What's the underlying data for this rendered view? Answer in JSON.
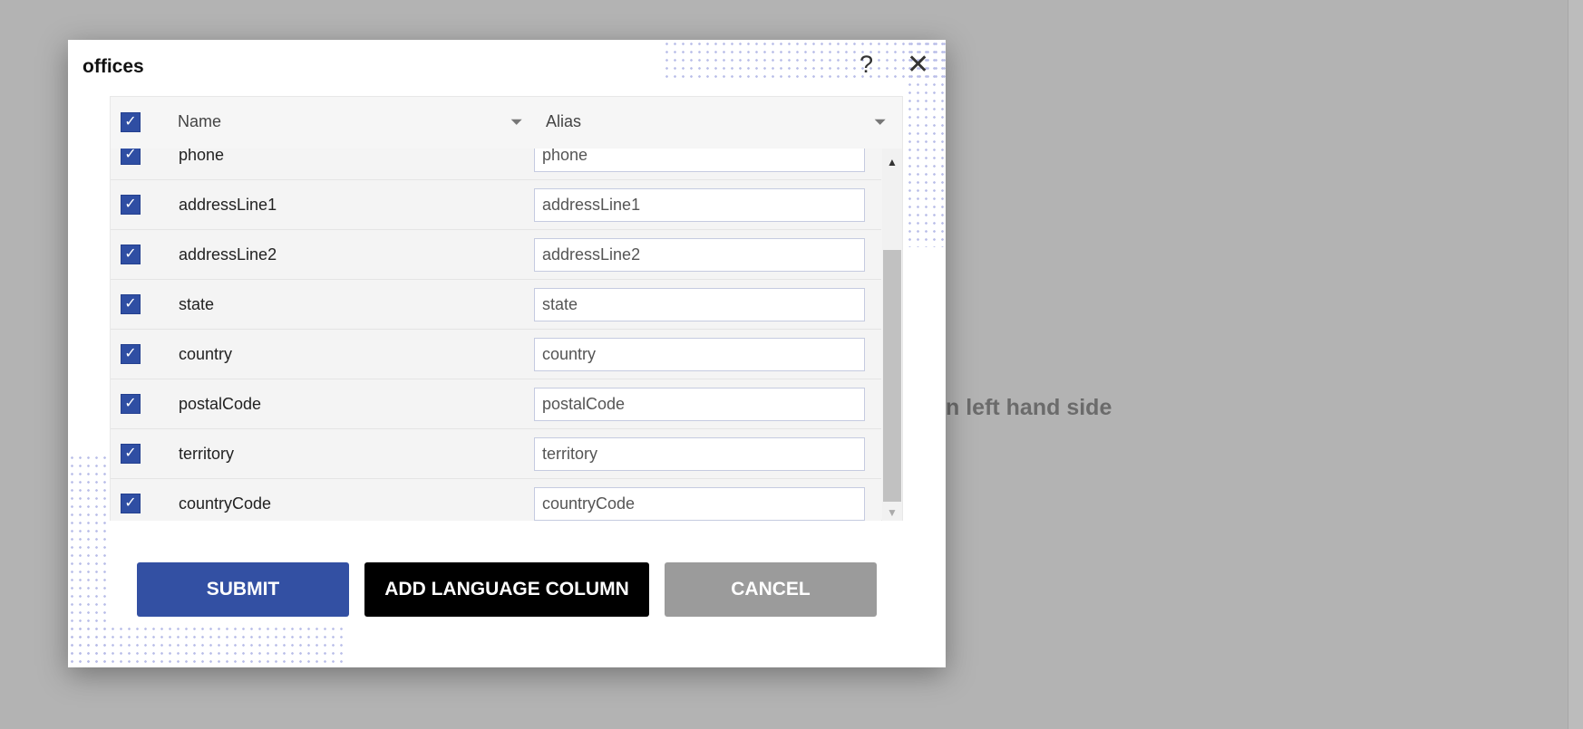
{
  "background_text": "n left hand side",
  "dialog": {
    "title": "offices",
    "help_icon": "?",
    "close_icon": "✕",
    "columns": {
      "name": "Name",
      "alias": "Alias"
    },
    "rows": [
      {
        "name": "phone",
        "alias": "phone",
        "checked": true
      },
      {
        "name": "addressLine1",
        "alias": "addressLine1",
        "checked": true
      },
      {
        "name": "addressLine2",
        "alias": "addressLine2",
        "checked": true
      },
      {
        "name": "state",
        "alias": "state",
        "checked": true
      },
      {
        "name": "country",
        "alias": "country",
        "checked": true
      },
      {
        "name": "postalCode",
        "alias": "postalCode",
        "checked": true
      },
      {
        "name": "territory",
        "alias": "territory",
        "checked": true
      },
      {
        "name": "countryCode",
        "alias": "countryCode",
        "checked": true
      }
    ],
    "buttons": {
      "submit": "SUBMIT",
      "add_language": "ADD LANGUAGE COLUMN",
      "cancel": "CANCEL"
    },
    "colors": {
      "primary": "#3350a3",
      "dark": "#000000",
      "cancel": "#9b9b9b"
    }
  }
}
